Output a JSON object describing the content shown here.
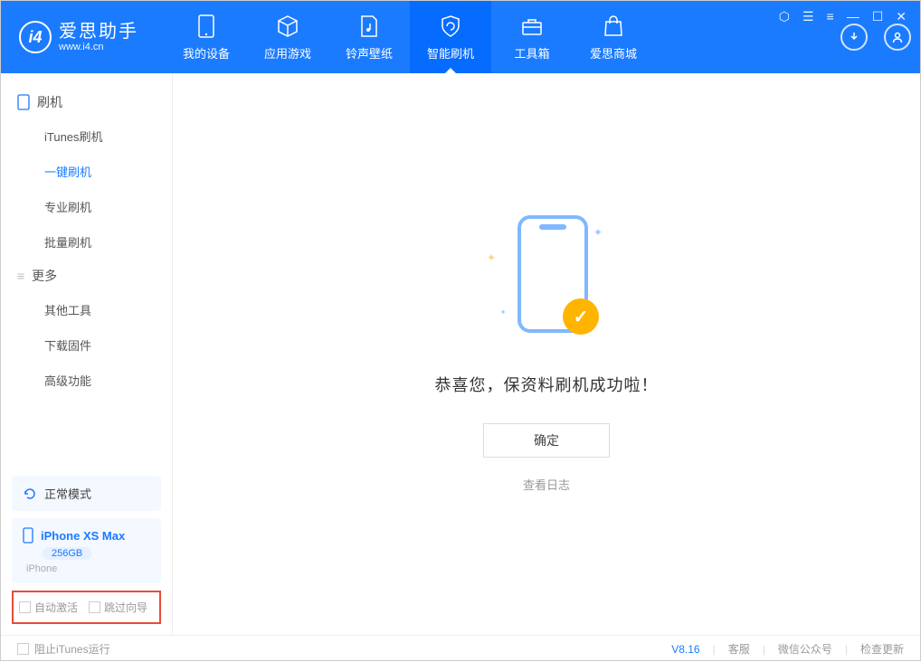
{
  "app": {
    "title": "爱思助手",
    "subtitle": "www.i4.cn"
  },
  "nav": [
    {
      "label": "我的设备"
    },
    {
      "label": "应用游戏"
    },
    {
      "label": "铃声壁纸"
    },
    {
      "label": "智能刷机"
    },
    {
      "label": "工具箱"
    },
    {
      "label": "爱思商城"
    }
  ],
  "sidebar": {
    "section1": {
      "title": "刷机",
      "items": [
        "iTunes刷机",
        "一键刷机",
        "专业刷机",
        "批量刷机"
      ]
    },
    "section2": {
      "title": "更多",
      "items": [
        "其他工具",
        "下载固件",
        "高级功能"
      ]
    },
    "mode_label": "正常模式",
    "device": {
      "name": "iPhone XS Max",
      "capacity": "256GB",
      "type": "iPhone"
    },
    "check1": "自动激活",
    "check2": "跳过向导"
  },
  "main": {
    "success_text": "恭喜您，保资料刷机成功啦！",
    "ok_button": "确定",
    "log_link": "查看日志"
  },
  "footer": {
    "block_itunes": "阻止iTunes运行",
    "version": "V8.16",
    "service": "客服",
    "wechat": "微信公众号",
    "update": "检查更新"
  }
}
